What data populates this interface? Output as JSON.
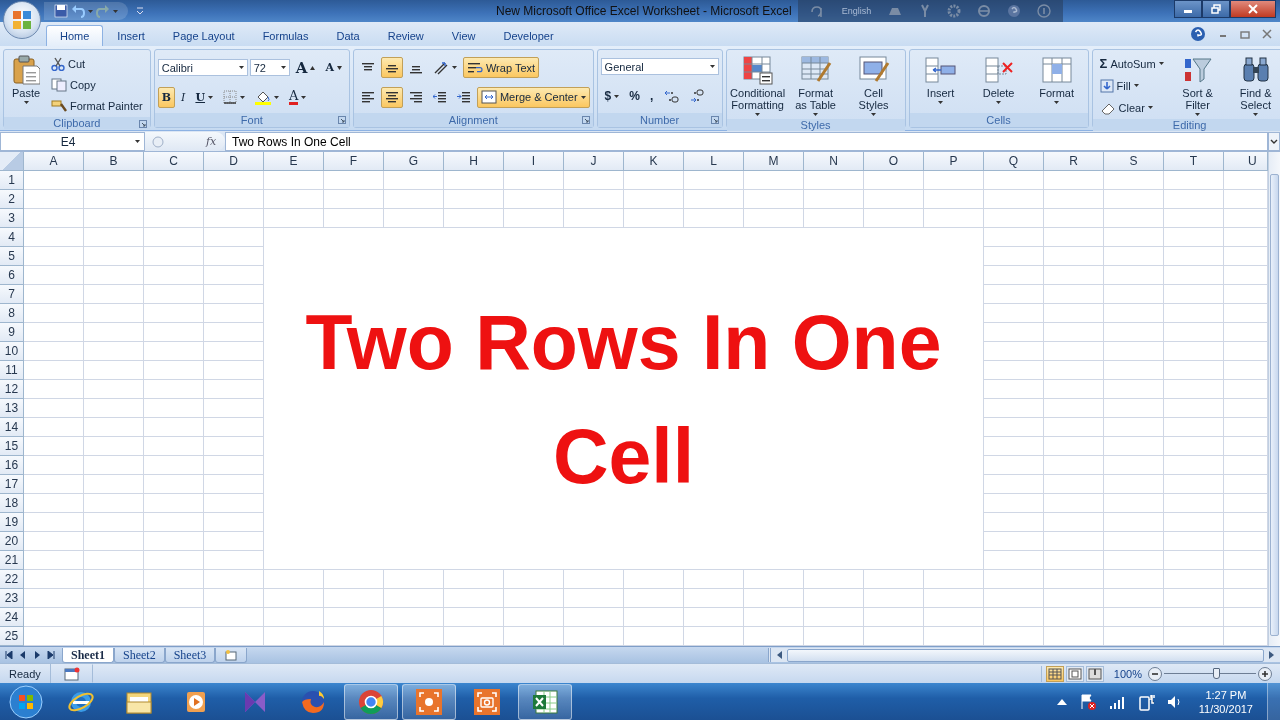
{
  "window": {
    "title": "New Microsoft Office Excel Worksheet - Microsoft Excel"
  },
  "language_bar": {
    "language": "English"
  },
  "tabs": [
    {
      "label": "Home",
      "selected": true
    },
    {
      "label": "Insert",
      "selected": false
    },
    {
      "label": "Page Layout",
      "selected": false
    },
    {
      "label": "Formulas",
      "selected": false
    },
    {
      "label": "Data",
      "selected": false
    },
    {
      "label": "Review",
      "selected": false
    },
    {
      "label": "View",
      "selected": false
    },
    {
      "label": "Developer",
      "selected": false
    }
  ],
  "ribbon_groups": [
    {
      "name": "Clipboard",
      "launcher": true,
      "columns": [
        {
          "kind": "large",
          "controls": [
            {
              "kind": "paste",
              "lines": [
                "Paste"
              ],
              "dropdown": true
            }
          ]
        },
        {
          "kind": "rows",
          "rows": [
            {
              "controls": [
                {
                  "kind": "cut",
                  "label": "Cut"
                }
              ]
            },
            {
              "controls": [
                {
                  "kind": "copy",
                  "label": "Copy"
                }
              ]
            },
            {
              "controls": [
                {
                  "kind": "format-painter",
                  "label": "Format Painter"
                }
              ]
            }
          ]
        }
      ]
    },
    {
      "name": "Font",
      "launcher": true,
      "columns": [
        {
          "kind": "rows",
          "rows": [
            {
              "controls": [
                {
                  "kind": "font-field",
                  "value": "Calibri"
                },
                {
                  "kind": "size-field",
                  "value": "72"
                },
                {
                  "kind": "grow-font",
                  "label": "A"
                },
                {
                  "kind": "shrink-font",
                  "label": "A"
                }
              ]
            },
            {
              "controls": [
                {
                  "kind": "bold",
                  "label": "B",
                  "selected": true
                },
                {
                  "kind": "italic",
                  "label": "I",
                  "selected": false
                },
                {
                  "kind": "underline",
                  "label": "U",
                  "selected": false,
                  "dropdown": true
                },
                {
                  "kind": "borders",
                  "dropdown": true
                },
                {
                  "kind": "fill-color",
                  "dropdown": true
                },
                {
                  "kind": "font-color",
                  "label": "A",
                  "dropdown": true
                }
              ]
            }
          ]
        }
      ]
    },
    {
      "name": "Alignment",
      "launcher": true,
      "columns": [
        {
          "kind": "rows",
          "rows": [
            {
              "controls": [
                {
                  "kind": "align-top",
                  "selected": false
                },
                {
                  "kind": "align-middle",
                  "selected": true
                },
                {
                  "kind": "align-bottom",
                  "selected": false
                },
                {
                  "kind": "orientation",
                  "dropdown": true
                },
                {
                  "kind": "wrap-text",
                  "label": "Wrap Text",
                  "selected": true
                }
              ]
            },
            {
              "controls": [
                {
                  "kind": "align-left",
                  "selected": false
                },
                {
                  "kind": "align-center",
                  "selected": true
                },
                {
                  "kind": "align-right",
                  "selected": false
                },
                {
                  "kind": "outdent"
                },
                {
                  "kind": "indent"
                },
                {
                  "kind": "merge-center",
                  "label": "Merge & Center",
                  "selected": true,
                  "dropdown": true
                }
              ]
            }
          ]
        }
      ]
    },
    {
      "name": "Number",
      "launcher": true,
      "columns": [
        {
          "kind": "rows",
          "rows": [
            {
              "controls": [
                {
                  "kind": "format-field",
                  "value": "General"
                }
              ]
            },
            {
              "controls": [
                {
                  "kind": "currency",
                  "label": "$",
                  "dropdown": true
                },
                {
                  "kind": "percent",
                  "label": "%"
                },
                {
                  "kind": "comma",
                  "label": ","
                },
                {
                  "kind": "increase-decimal"
                },
                {
                  "kind": "decrease-decimal"
                }
              ]
            }
          ]
        }
      ]
    },
    {
      "name": "Styles",
      "launcher": false,
      "columns": [
        {
          "kind": "large",
          "controls": [
            {
              "kind": "conditional-formatting",
              "lines": [
                "Conditional",
                "Formatting"
              ],
              "dropdown": true
            },
            {
              "kind": "format-as-table",
              "lines": [
                "Format",
                "as Table"
              ],
              "dropdown": true
            },
            {
              "kind": "cell-styles",
              "lines": [
                "Cell",
                "Styles"
              ],
              "dropdown": true
            }
          ]
        }
      ]
    },
    {
      "name": "Cells",
      "launcher": false,
      "columns": [
        {
          "kind": "large",
          "controls": [
            {
              "kind": "insert-cells",
              "lines": [
                "Insert"
              ],
              "dropdown": true
            },
            {
              "kind": "delete-cells",
              "lines": [
                "Delete"
              ],
              "dropdown": true
            },
            {
              "kind": "format-cells",
              "lines": [
                "Format"
              ],
              "dropdown": true
            }
          ]
        }
      ]
    },
    {
      "name": "Editing",
      "launcher": false,
      "columns": [
        {
          "kind": "rows",
          "rows": [
            {
              "controls": [
                {
                  "kind": "autosum",
                  "symbol": "Σ",
                  "label": "AutoSum",
                  "dropdown": true
                }
              ]
            },
            {
              "controls": [
                {
                  "kind": "fill",
                  "label": "Fill",
                  "dropdown": true
                }
              ]
            },
            {
              "controls": [
                {
                  "kind": "clear",
                  "label": "Clear",
                  "dropdown": true
                }
              ]
            }
          ]
        },
        {
          "kind": "large",
          "controls": [
            {
              "kind": "sort-filter",
              "lines": [
                "Sort &",
                "Filter"
              ],
              "dropdown": true
            },
            {
              "kind": "find-select",
              "lines": [
                "Find &",
                "Select"
              ],
              "dropdown": true
            }
          ]
        }
      ]
    }
  ],
  "formula_bar": {
    "name_box": "E4",
    "fx": "fx",
    "formula": "Two Rows In One Cell"
  },
  "sheet": {
    "columns": [
      "A",
      "B",
      "C",
      "D",
      "E",
      "F",
      "G",
      "H",
      "I",
      "J",
      "K",
      "L",
      "M",
      "N",
      "O",
      "P",
      "Q",
      "R",
      "S",
      "T",
      "U"
    ],
    "rows": [
      "1",
      "2",
      "3",
      "4",
      "5",
      "6",
      "7",
      "8",
      "9",
      "10",
      "11",
      "12",
      "13",
      "14",
      "15",
      "16",
      "17",
      "18",
      "19",
      "20",
      "21",
      "22",
      "23",
      "24",
      "25"
    ],
    "merged_cell": {
      "text": "Two Rows In One Cell"
    }
  },
  "sheet_tabs": [
    {
      "label": "Sheet1",
      "selected": true
    },
    {
      "label": "Sheet2",
      "selected": false
    },
    {
      "label": "Sheet3",
      "selected": false
    }
  ],
  "status_bar": {
    "status": "Ready",
    "views": [
      {
        "kind": "normal",
        "selected": true
      },
      {
        "kind": "page-layout",
        "selected": false
      },
      {
        "kind": "page-break",
        "selected": false
      }
    ],
    "zoom": "100%",
    "zoom_level": {
      "level": 0.56
    }
  },
  "taskbar": {
    "items": [
      {
        "kind": "browser-e",
        "active": false
      },
      {
        "kind": "folder",
        "active": false
      },
      {
        "kind": "media",
        "active": false
      },
      {
        "kind": "bowtie",
        "active": false
      },
      {
        "kind": "fox",
        "active": false
      },
      {
        "kind": "wheel",
        "active": true
      },
      {
        "kind": "recorder",
        "active": true
      },
      {
        "kind": "camera",
        "active": false
      },
      {
        "kind": "spreadsheet",
        "active": true
      }
    ],
    "time": "1:27 PM",
    "date": "11/30/2017"
  }
}
